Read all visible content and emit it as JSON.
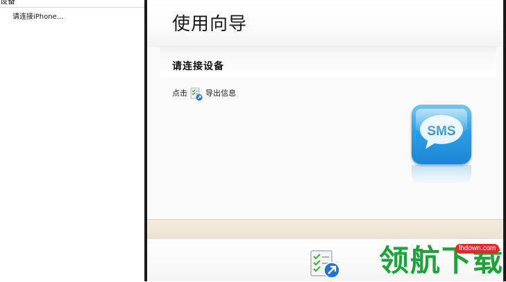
{
  "left_panel": {
    "header": "设备",
    "items": [
      "请连接iPhone..."
    ]
  },
  "main": {
    "title": "使用向导",
    "section_heading": "请连接设备",
    "instruction_prefix": "点击",
    "instruction_suffix": "导出信息",
    "app_icon_text": "SMS"
  },
  "icons": {
    "export": "export-icon",
    "sms_app": "sms-app-icon"
  },
  "watermark": {
    "text": "领航下载",
    "url": "lhdown.com"
  },
  "colors": {
    "sms_blue": "#2b9fe6",
    "watermark_green": "#1fa23a",
    "watermark_badge": "#e8262b",
    "frame": "#1a1a1a"
  }
}
